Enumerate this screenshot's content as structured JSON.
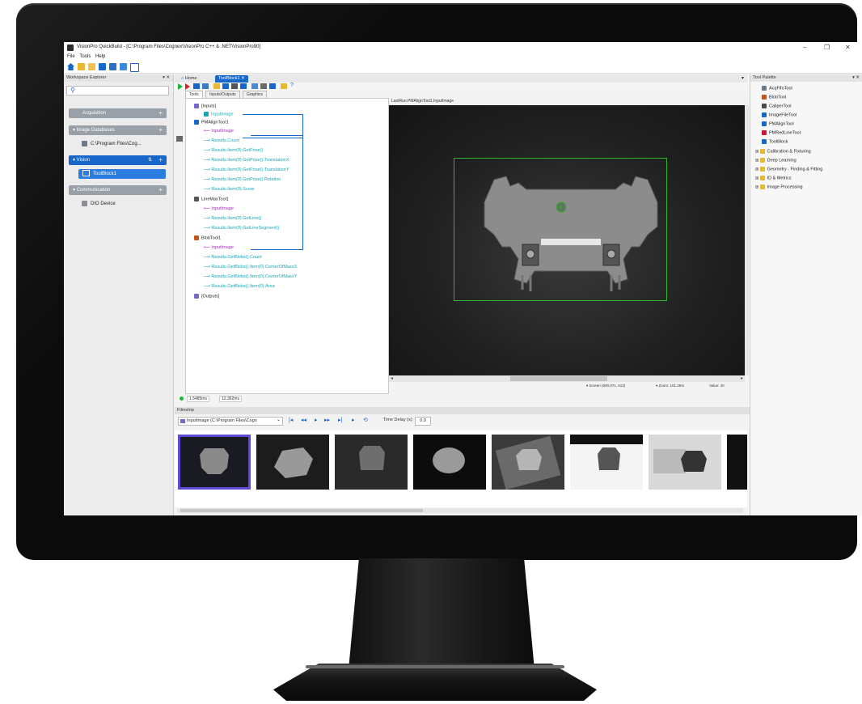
{
  "window": {
    "title": "VisionPro QuickBuild - [C:\\Program Files\\Cognex\\VisionPro C++ & .NET\\VisionPro90]",
    "minimize": "–",
    "maximize": "❐",
    "close": "✕"
  },
  "menu": [
    "File",
    "Tools",
    "Help"
  ],
  "workspace": {
    "header": "Workspace Explorer",
    "pin": "▾ ✕",
    "sections": [
      {
        "label": "Acquisition",
        "action": "+"
      },
      {
        "label": "▾ Image Databases",
        "action": "+"
      },
      {
        "label": "▾ Vision",
        "action": "+"
      },
      {
        "label": "▾ Communication",
        "action": "+"
      }
    ],
    "db_item": "C:\\Program Files\\Cog...",
    "toolblock_item": "ToolBlock1",
    "device_item": "DIO Device",
    "vision_sort": "⇅"
  },
  "tabs": {
    "home": "Home",
    "active": "ToolBlock1",
    "close": "✕",
    "overflow": "▾"
  },
  "subtabs": [
    "Tools",
    "Inputs/Outputs",
    "Graphics"
  ],
  "tree": {
    "inputs": "[Inputs]",
    "input_image": "InputImage",
    "pmalign": "PMAlignTool1",
    "pm_input": "InputImage",
    "pm_results": [
      "Results.Count",
      "Results.Item(0).GetPose()",
      "Results.Item(0).GetPose().TranslationX",
      "Results.Item(0).GetPose().TranslationY",
      "Results.Item(0).GetPose().Rotation",
      "Results.Item(0).Score"
    ],
    "linemax": "LineMaxTool1",
    "lm_input": "InputImage",
    "lm_results": [
      "Results.Item(0).GetLine()",
      "Results.Item(0).GetLineSegment()"
    ],
    "blob": "BlobTool1",
    "blob_input": "InputImage",
    "blob_results": [
      "Results.GetBlobs().Count",
      "Results.GetBlobs().Item(0).CenterOfMassX",
      "Results.GetBlobs().Item(0).CenterOfMassY",
      "Results.GetBlobs().Item(0).Area"
    ],
    "outputs": "[Outputs]"
  },
  "image_view": {
    "header": "LastRun.PMAlignTool1.InputImage",
    "status_coords": "▾ Screen (500.071, 513)",
    "status_zoom": "▾ Zoom: 101.25%",
    "status_value": "Value: 40",
    "scroll_left": "◂",
    "scroll_right": "▸"
  },
  "timing": {
    "total": "1.5485ms",
    "last": "12.362ms"
  },
  "filmstrip": {
    "header": "Filmstrip",
    "source": "InputImage (C:\\Program Files\\Cogn",
    "delay_label": "Time Delay (s):",
    "delay_value": "0.0",
    "controls": [
      "|◂",
      "◂◂",
      "▸",
      "▸▸",
      "▸|",
      "▸",
      "⟲"
    ]
  },
  "palette": {
    "header": "Tool Palette",
    "items": [
      "AcqFifoTool",
      "BlobTool",
      "CaliperTool",
      "ImageFileTool",
      "PMAlignTool",
      "PMRedLineTool",
      "ToolBlock"
    ],
    "folders": [
      "Calibration & Fixturing",
      "Deep Learning",
      "Geometry - Finding & Fitting",
      "ID & Metrics",
      "Image Processing"
    ]
  },
  "colors": {
    "accent": "#1766c9",
    "roi": "#2db52d",
    "input_link": "#b026c9",
    "output_link": "#1aa6b5"
  }
}
